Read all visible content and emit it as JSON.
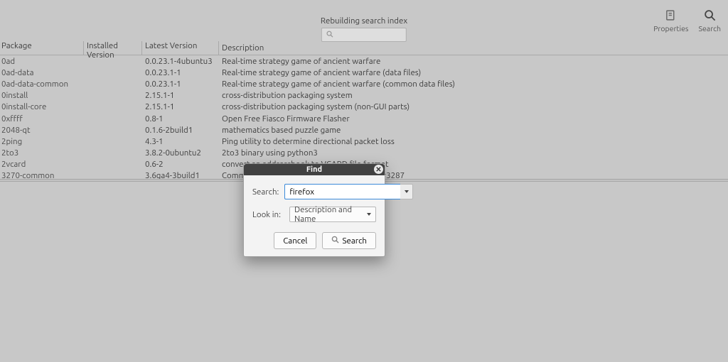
{
  "top": {
    "status_text": "Rebuilding search index",
    "search_placeholder": ""
  },
  "toolbar": {
    "properties_label": "Properties",
    "search_label": "Search"
  },
  "columns": {
    "package": "Package",
    "installed": "Installed Version",
    "latest": "Latest Version",
    "description": "Description"
  },
  "packages": [
    {
      "name": "0ad",
      "installed": "",
      "latest": "0.0.23.1-4ubuntu3",
      "desc": "Real-time strategy game of ancient warfare"
    },
    {
      "name": "0ad-data",
      "installed": "",
      "latest": "0.0.23.1-1",
      "desc": "Real-time strategy game of ancient warfare (data files)"
    },
    {
      "name": "0ad-data-common",
      "installed": "",
      "latest": "0.0.23.1-1",
      "desc": "Real-time strategy game of ancient warfare (common data files)"
    },
    {
      "name": "0install",
      "installed": "",
      "latest": "2.15.1-1",
      "desc": "cross-distribution packaging system"
    },
    {
      "name": "0install-core",
      "installed": "",
      "latest": "2.15.1-1",
      "desc": "cross-distribution packaging system (non-GUI parts)"
    },
    {
      "name": "0xffff",
      "installed": "",
      "latest": "0.8-1",
      "desc": "Open Free Fiasco Firmware Flasher"
    },
    {
      "name": "2048-qt",
      "installed": "",
      "latest": "0.1.6-2build1",
      "desc": "mathematics based puzzle game"
    },
    {
      "name": "2ping",
      "installed": "",
      "latest": "4.3-1",
      "desc": "Ping utility to determine directional packet loss"
    },
    {
      "name": "2to3",
      "installed": "",
      "latest": "3.8.2-0ubuntu2",
      "desc": "2to3 binary using python3"
    },
    {
      "name": "2vcard",
      "installed": "",
      "latest": "0.6-2",
      "desc": "convert an addressbook to VCARD file format"
    },
    {
      "name": "3270-common",
      "installed": "",
      "latest": "3.6ga4-3build1",
      "desc": "Common files for IBM 3270 emulators and pr3287"
    }
  ],
  "dialog": {
    "title": "Find",
    "search_label": "Search:",
    "search_value": "firefox",
    "lookin_label": "Look in:",
    "lookin_value": "Description and Name",
    "cancel_label": "Cancel",
    "search_button_label": "Search"
  }
}
